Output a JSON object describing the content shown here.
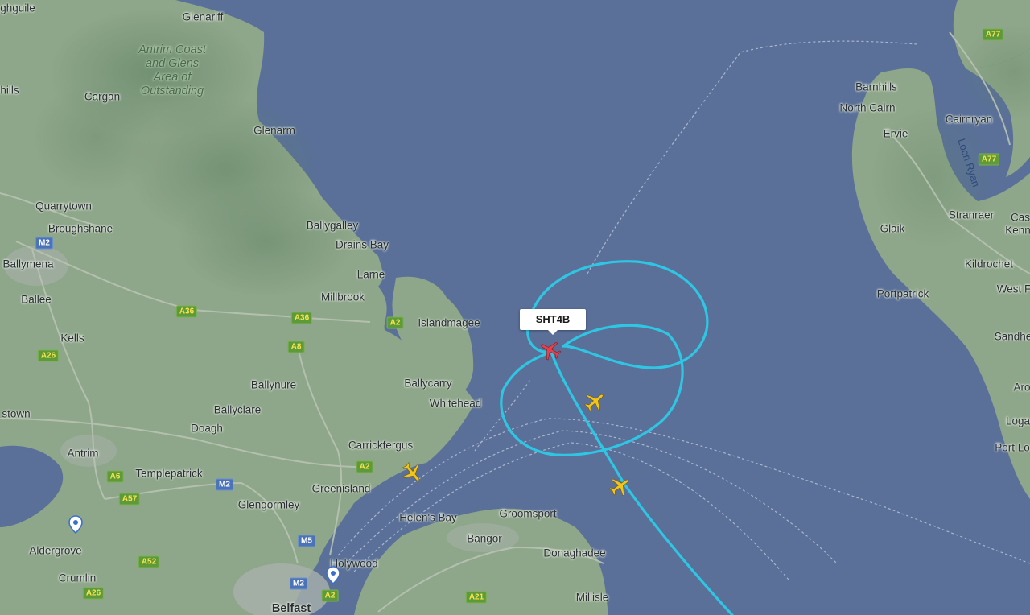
{
  "flight": {
    "callsign": "SHT4B"
  },
  "places": [
    {
      "key": "ghguile",
      "text": "ghguile"
    },
    {
      "key": "glenariff",
      "text": "Glenariff"
    },
    {
      "key": "hills",
      "text": "hills"
    },
    {
      "key": "cargan",
      "text": "Cargan"
    },
    {
      "key": "glenarm",
      "text": "Glenarm"
    },
    {
      "key": "quarrytown",
      "text": "Quarrytown"
    },
    {
      "key": "broughshane",
      "text": "Broughshane"
    },
    {
      "key": "ballymena",
      "text": "Ballymena"
    },
    {
      "key": "ballee",
      "text": "Ballee"
    },
    {
      "key": "kells",
      "text": "Kells"
    },
    {
      "key": "ballygalley",
      "text": "Ballygalley"
    },
    {
      "key": "drainsbay",
      "text": "Drains Bay"
    },
    {
      "key": "larne",
      "text": "Larne"
    },
    {
      "key": "millbrook",
      "text": "Millbrook"
    },
    {
      "key": "islandmagee",
      "text": "Islandmagee"
    },
    {
      "key": "ballynure",
      "text": "Ballynure"
    },
    {
      "key": "ballycarry",
      "text": "Ballycarry"
    },
    {
      "key": "whitehead",
      "text": "Whitehead"
    },
    {
      "key": "ballyclare",
      "text": "Ballyclare"
    },
    {
      "key": "stown",
      "text": "stown"
    },
    {
      "key": "doagh",
      "text": "Doagh"
    },
    {
      "key": "carrickfergus",
      "text": "Carrickfergus"
    },
    {
      "key": "antrim",
      "text": "Antrim"
    },
    {
      "key": "templepatrick",
      "text": "Templepatrick"
    },
    {
      "key": "greenisland",
      "text": "Greenisland"
    },
    {
      "key": "glengormley",
      "text": "Glengormley"
    },
    {
      "key": "helensbay",
      "text": "Helen's Bay"
    },
    {
      "key": "groomsport",
      "text": "Groomsport"
    },
    {
      "key": "bangor",
      "text": "Bangor"
    },
    {
      "key": "aldergrove",
      "text": "Aldergrove"
    },
    {
      "key": "holywood",
      "text": "Holywood"
    },
    {
      "key": "donaghadee",
      "text": "Donaghadee"
    },
    {
      "key": "crumlin",
      "text": "Crumlin"
    },
    {
      "key": "millisle",
      "text": "Millisle"
    },
    {
      "key": "belfast",
      "text": "Belfast"
    },
    {
      "key": "barnhills",
      "text": "Barnhills"
    },
    {
      "key": "northcairn",
      "text": "North Cairn"
    },
    {
      "key": "cairnryan",
      "text": "Cairnryan"
    },
    {
      "key": "ervie",
      "text": "Ervie"
    },
    {
      "key": "stranraer",
      "text": "Stranraer"
    },
    {
      "key": "cas",
      "text": "Cas"
    },
    {
      "key": "kenn",
      "text": "Kenn"
    },
    {
      "key": "glaik",
      "text": "Glaik"
    },
    {
      "key": "kildrochet",
      "text": "Kildrochet"
    },
    {
      "key": "portpatrick",
      "text": "Portpatrick"
    },
    {
      "key": "west",
      "text": "West F"
    },
    {
      "key": "sandhe",
      "text": "Sandhe"
    },
    {
      "key": "aro",
      "text": "Aro"
    },
    {
      "key": "loga",
      "text": "Loga"
    },
    {
      "key": "portlo",
      "text": "Port Lo"
    }
  ],
  "park_label": "Antrim Coast\nand Glens\nArea of\nOutstanding",
  "water_label": "Loch Ryan",
  "roads": [
    {
      "key": "m2a",
      "text": "M2",
      "type": "m"
    },
    {
      "key": "m2b",
      "text": "M2",
      "type": "m"
    },
    {
      "key": "m2c",
      "text": "M2",
      "type": "m"
    },
    {
      "key": "m5",
      "text": "M5",
      "type": "m"
    },
    {
      "key": "a36a",
      "text": "A36",
      "type": "a"
    },
    {
      "key": "a36b",
      "text": "A36",
      "type": "a"
    },
    {
      "key": "a2a",
      "text": "A2",
      "type": "a"
    },
    {
      "key": "a8",
      "text": "A8",
      "type": "a"
    },
    {
      "key": "a26a",
      "text": "A26",
      "type": "a"
    },
    {
      "key": "a6",
      "text": "A6",
      "type": "a"
    },
    {
      "key": "a57",
      "text": "A57",
      "type": "a"
    },
    {
      "key": "a52",
      "text": "A52",
      "type": "a"
    },
    {
      "key": "a2b",
      "text": "A2",
      "type": "a"
    },
    {
      "key": "a2c",
      "text": "A2",
      "type": "a"
    },
    {
      "key": "a26b",
      "text": "A26",
      "type": "a"
    },
    {
      "key": "a21",
      "text": "A21",
      "type": "a"
    },
    {
      "key": "a77a",
      "text": "A77",
      "type": "a"
    },
    {
      "key": "a77b",
      "text": "A77",
      "type": "a"
    }
  ],
  "colors": {
    "sea": "#5a7099",
    "land": "#8ea68a",
    "track": "#2fc6e3",
    "selected_plane": "#e5404c",
    "plane": "#f3c51c"
  }
}
